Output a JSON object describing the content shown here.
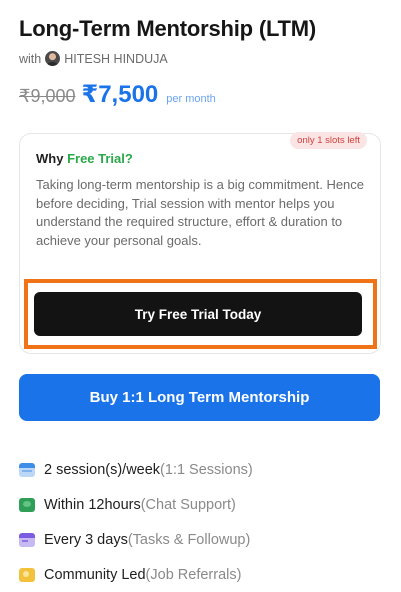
{
  "header": {
    "title": "Long-Term Mentorship (LTM)",
    "mentor_prefix": "with",
    "mentor_name": "HITESH HINDUJA"
  },
  "pricing": {
    "old_price": "₹9,000",
    "new_price": "₹7,500",
    "period": "per month"
  },
  "trial": {
    "badge": "only 1 slots left",
    "why_prefix": "Why",
    "why_accent": "Free Trial?",
    "description": "Taking long-term mentorship is a big commitment. Hence before deciding, Trial session with mentor helps you understand the required structure, effort & duration to achieve your personal goals.",
    "button_label": "Try Free Trial Today"
  },
  "buy": {
    "button_label": "Buy 1:1 Long Term Mentorship"
  },
  "features": [
    {
      "icon": "calendar-icon",
      "main": "2 session(s)/week",
      "sub": "(1:1 Sessions)"
    },
    {
      "icon": "chat-icon",
      "main": "Within 12hours",
      "sub": "(Chat Support)"
    },
    {
      "icon": "tasks-icon",
      "main": "Every 3 days",
      "sub": "(Tasks & Followup)"
    },
    {
      "icon": "community-icon",
      "main": "Community Led",
      "sub": " (Job Referrals)"
    }
  ],
  "colors": {
    "accent_blue": "#1a73e8",
    "accent_green": "#2aa84a",
    "highlight_orange": "#f07318",
    "badge_red": "#d0413c"
  }
}
